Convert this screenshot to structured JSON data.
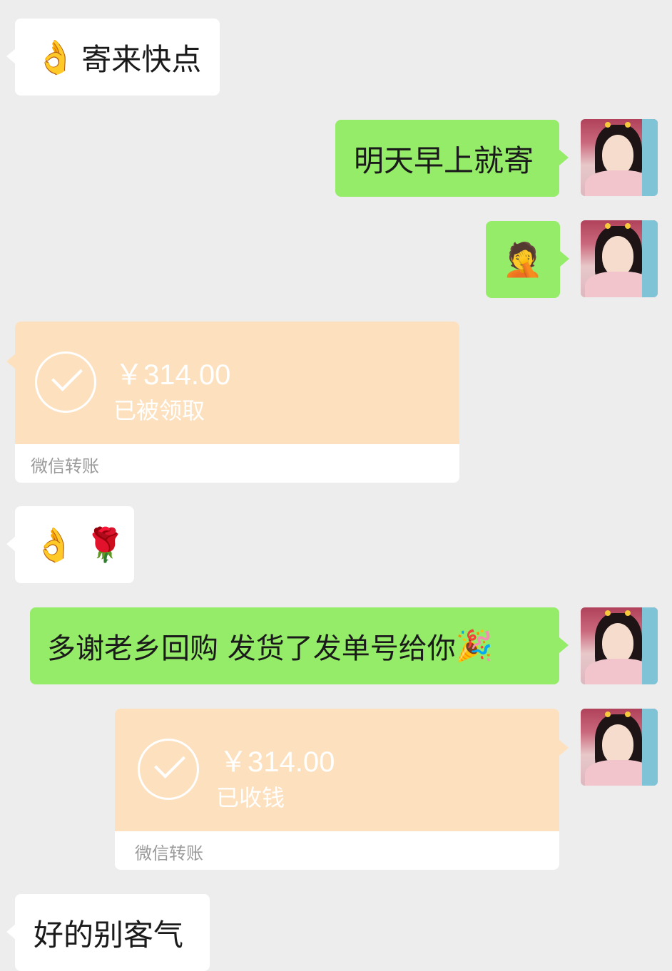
{
  "messages": [
    {
      "side": "left",
      "type": "text",
      "emoji": "👌",
      "text": "寄来快点"
    },
    {
      "side": "right",
      "type": "text",
      "text": "明天早上就寄"
    },
    {
      "side": "right",
      "type": "emoji",
      "emoji": "🤦"
    },
    {
      "side": "left",
      "type": "transfer",
      "amount": "￥314.00",
      "status": "已被领取",
      "label": "微信转账"
    },
    {
      "side": "left",
      "type": "emoji",
      "emoji": "👌 🌹"
    },
    {
      "side": "right",
      "type": "text",
      "text": "多谢老乡回购 发货了发单号给你",
      "emoji": "🎉"
    },
    {
      "side": "right",
      "type": "transfer",
      "amount": "￥314.00",
      "status": "已收钱",
      "label": "微信转账"
    },
    {
      "side": "left",
      "type": "text",
      "text": "好的别客气"
    }
  ],
  "colors": {
    "background": "#ededed",
    "bubble_left": "#ffffff",
    "bubble_right": "#95ec69",
    "transfer": "#fde1bf"
  }
}
